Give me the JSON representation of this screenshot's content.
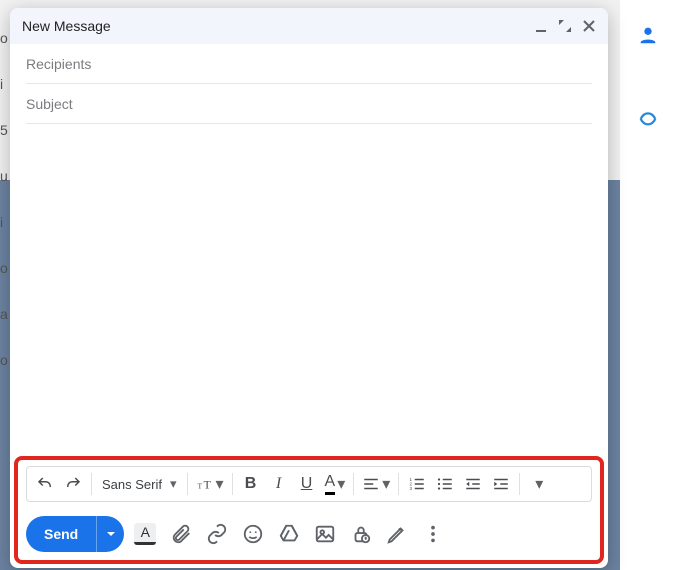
{
  "header": {
    "title": "New Message"
  },
  "fields": {
    "recipients_placeholder": "Recipients",
    "recipients_value": "",
    "subject_placeholder": "Subject",
    "subject_value": ""
  },
  "body": {
    "content": ""
  },
  "format_toolbar": {
    "font_label": "Sans Serif"
  },
  "send": {
    "label": "Send"
  }
}
